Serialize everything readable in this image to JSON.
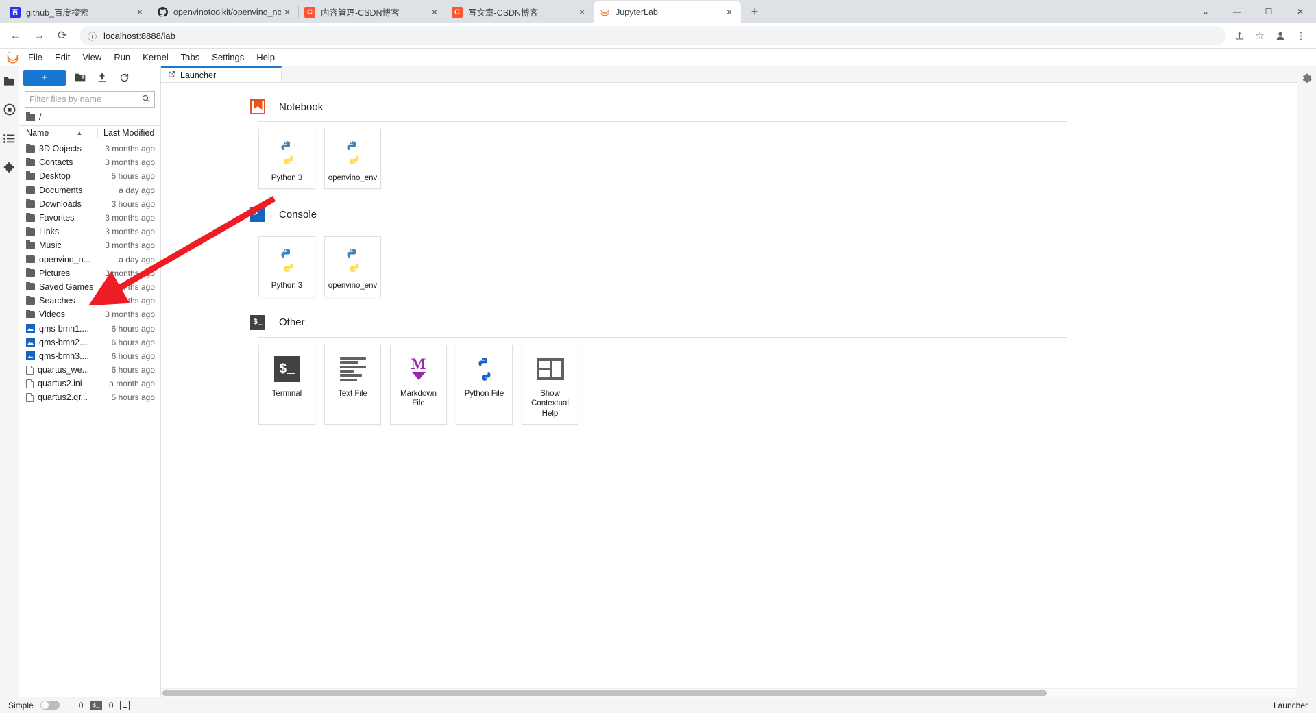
{
  "browser": {
    "tabs": [
      {
        "title": "github_百度搜索",
        "favicon": "baidu-icon",
        "active": false
      },
      {
        "title": "openvinotoolkit/openvino_not",
        "favicon": "github-icon",
        "active": false
      },
      {
        "title": "内容管理-CSDN博客",
        "favicon": "csdn-icon",
        "active": false
      },
      {
        "title": "写文章-CSDN博客",
        "favicon": "csdn-icon",
        "active": false
      },
      {
        "title": "JupyterLab",
        "favicon": "jupyter-icon",
        "active": true
      }
    ],
    "new_tab_label": "+",
    "window_controls": {
      "minimize": "—",
      "maximize": "☐",
      "close": "✕",
      "more": "⌄"
    },
    "nav": {
      "back": "←",
      "forward": "→",
      "reload": "⟳"
    },
    "omnibox": {
      "value": "localhost:8888/lab",
      "info_icon": "info-icon",
      "share_icon": "share-icon",
      "star_icon": "star-icon"
    },
    "profile_icon": "profile-icon",
    "menu_icon": "kebab-menu-icon"
  },
  "jupyter": {
    "logo": "jupyter-logo",
    "menubar": [
      "File",
      "Edit",
      "View",
      "Run",
      "Kernel",
      "Tabs",
      "Settings",
      "Help"
    ],
    "left_sidebar_icons": [
      "folder-icon",
      "running-icon",
      "commands-icon",
      "extensions-icon"
    ],
    "right_sidebar_icons": [
      "property-inspector-icon"
    ],
    "filebrowser": {
      "new_launcher_label": "+",
      "toolbar_icons": [
        "new-folder-icon",
        "upload-icon",
        "refresh-icon"
      ],
      "filter_placeholder": "Filter files by name",
      "search_icon": "search-icon",
      "breadcrumb": "/",
      "columns": {
        "name": "Name",
        "last_modified": "Last Modified",
        "sort_indicator": "▲"
      },
      "items": [
        {
          "name": "3D Objects",
          "modified": "3 months ago",
          "type": "folder"
        },
        {
          "name": "Contacts",
          "modified": "3 months ago",
          "type": "folder"
        },
        {
          "name": "Desktop",
          "modified": "5 hours ago",
          "type": "folder"
        },
        {
          "name": "Documents",
          "modified": "a day ago",
          "type": "folder"
        },
        {
          "name": "Downloads",
          "modified": "3 hours ago",
          "type": "folder"
        },
        {
          "name": "Favorites",
          "modified": "3 months ago",
          "type": "folder"
        },
        {
          "name": "Links",
          "modified": "3 months ago",
          "type": "folder"
        },
        {
          "name": "Music",
          "modified": "3 months ago",
          "type": "folder"
        },
        {
          "name": "openvino_n...",
          "modified": "a day ago",
          "type": "folder"
        },
        {
          "name": "Pictures",
          "modified": "3 months ago",
          "type": "folder"
        },
        {
          "name": "Saved Games",
          "modified": "3 months ago",
          "type": "folder"
        },
        {
          "name": "Searches",
          "modified": "3 months ago",
          "type": "folder"
        },
        {
          "name": "Videos",
          "modified": "3 months ago",
          "type": "folder"
        },
        {
          "name": "qms-bmh1....",
          "modified": "6 hours ago",
          "type": "image"
        },
        {
          "name": "qms-bmh2....",
          "modified": "6 hours ago",
          "type": "image"
        },
        {
          "name": "qms-bmh3....",
          "modified": "6 hours ago",
          "type": "image"
        },
        {
          "name": "quartus_we...",
          "modified": "6 hours ago",
          "type": "file"
        },
        {
          "name": "quartus2.ini",
          "modified": "a month ago",
          "type": "file"
        },
        {
          "name": "quartus2.qr...",
          "modified": "5 hours ago",
          "type": "file"
        }
      ]
    },
    "main_tab": {
      "label": "Launcher",
      "icon": "launcher-icon"
    },
    "launcher": {
      "sections": [
        {
          "title": "Notebook",
          "icon": "notebook-icon",
          "cards": [
            {
              "label": "Python 3",
              "icon": "python-icon"
            },
            {
              "label": "openvino_env",
              "icon": "python-icon"
            }
          ]
        },
        {
          "title": "Console",
          "icon": "console-icon",
          "cards": [
            {
              "label": "Python 3",
              "icon": "python-icon"
            },
            {
              "label": "openvino_env",
              "icon": "python-icon"
            }
          ]
        },
        {
          "title": "Other",
          "icon": "terminal-icon",
          "cards": [
            {
              "label": "Terminal",
              "icon": "terminal-icon"
            },
            {
              "label": "Text File",
              "icon": "text-file-icon"
            },
            {
              "label": "Markdown File",
              "icon": "markdown-icon"
            },
            {
              "label": "Python File",
              "icon": "python-file-icon"
            },
            {
              "label": "Show Contextual Help",
              "icon": "contextual-help-icon"
            }
          ]
        }
      ]
    },
    "statusbar": {
      "simple_label": "Simple",
      "toggle_state": "off",
      "kernel_count": "0",
      "terminal_chip": "$_",
      "terminal_count": "0",
      "cpu_icon": "cpu-icon",
      "right_label": "Launcher"
    }
  },
  "annotation": {
    "arrow_color": "#ee1c25",
    "points_to": "openvino_n..."
  }
}
